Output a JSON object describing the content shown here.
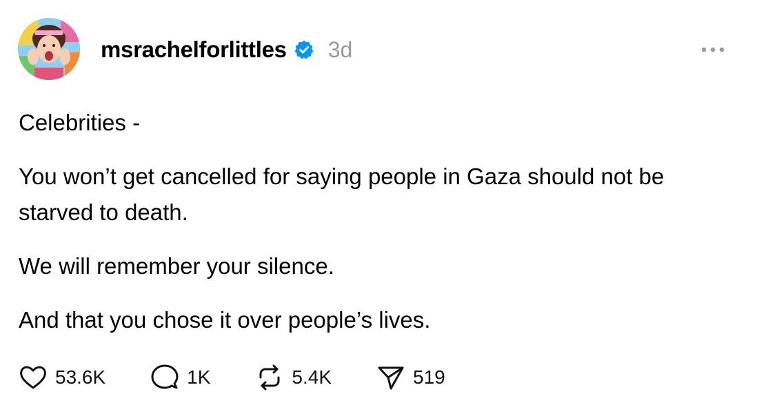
{
  "post": {
    "author": {
      "username": "msrachelforlittles",
      "verified_icon": "verified-badge-icon",
      "timestamp": "3d"
    },
    "more_icon": "more-options-icon",
    "paragraphs": [
      "Celebrities -",
      "You won’t get cancelled for saying people in Gaza should not be starved to death.",
      "We will remember your silence.",
      "And that you chose it over people’s lives."
    ],
    "actions": {
      "like": {
        "icon": "heart-icon",
        "count": "53.6K"
      },
      "reply": {
        "icon": "comment-icon",
        "count": "1K"
      },
      "repost": {
        "icon": "repost-icon",
        "count": "5.4K"
      },
      "share": {
        "icon": "send-icon",
        "count": "519"
      }
    },
    "colors": {
      "text": "#000000",
      "muted": "#999999",
      "verified": "#0095f6"
    }
  }
}
